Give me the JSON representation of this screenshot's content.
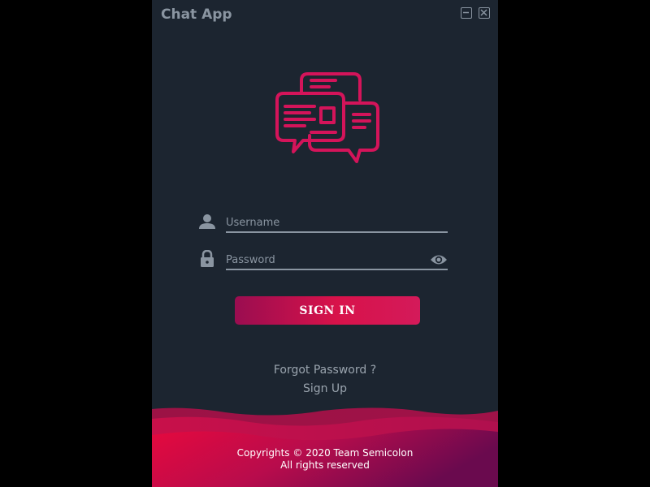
{
  "window": {
    "title": "Chat App",
    "minimize_icon": "minimize-icon",
    "close_icon": "close-icon"
  },
  "logo": {
    "icon": "chat-bubbles-icon",
    "color": "#d4145a"
  },
  "form": {
    "username": {
      "icon": "user-icon",
      "placeholder": "Username",
      "value": ""
    },
    "password": {
      "icon": "lock-icon",
      "placeholder": "Password",
      "value": "",
      "toggle_icon": "eye-icon"
    },
    "signin_label": "SIGN IN"
  },
  "links": {
    "forgot_password": "Forgot Password ?",
    "sign_up": "Sign Up"
  },
  "footer": {
    "line1": "Copyrights © 2020 Team Semicolon",
    "line2": "All rights reserved"
  },
  "colors": {
    "background": "#1c2530",
    "accent": "#d4145a",
    "accent_dark": "#9a0d50",
    "muted": "#8a95a1"
  }
}
